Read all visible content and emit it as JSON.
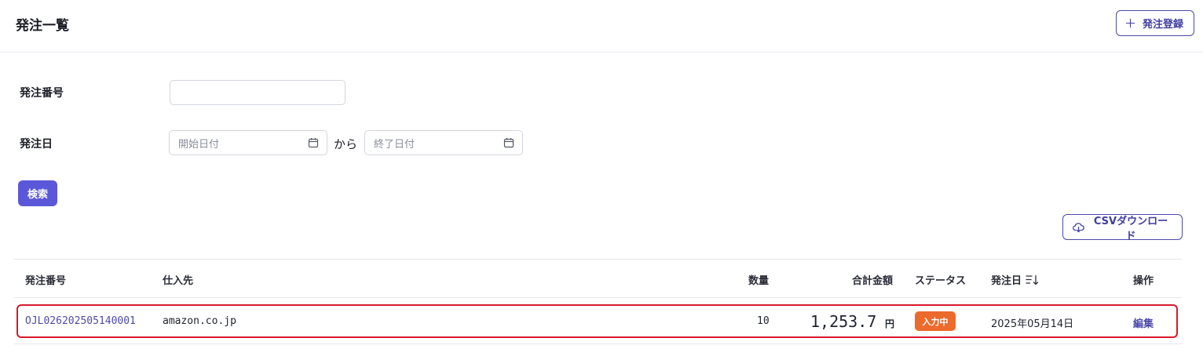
{
  "header": {
    "title": "発注一覧",
    "register_label": "発注登録"
  },
  "filters": {
    "order_no_label": "発注番号",
    "order_no_value": "",
    "date_label": "発注日",
    "start_placeholder": "開始日付",
    "range_sep": "から",
    "end_placeholder": "終了日付",
    "search_label": "検索"
  },
  "toolbar": {
    "csv_label": "CSVダウンロード"
  },
  "table": {
    "columns": {
      "order_no": "発注番号",
      "supplier": "仕入先",
      "qty": "数量",
      "amount": "合計金額",
      "status": "ステータス",
      "date": "発注日",
      "action": "操作"
    },
    "rows": [
      {
        "order_no": "OJL026202505140001",
        "supplier": "amazon.co.jp",
        "qty": "10",
        "amount": "1,253.7",
        "currency": "円",
        "status": "入力中",
        "date": "2025年05月14日",
        "action": "編集"
      }
    ]
  },
  "colors": {
    "accent": "#5b57d9",
    "link": "#4d4aa9",
    "status_badge": "#ec6a2c",
    "row_highlight": "#d8182d"
  },
  "icons": [
    "plus-icon",
    "calendar-icon",
    "cloud-download-icon",
    "sort-icon"
  ]
}
